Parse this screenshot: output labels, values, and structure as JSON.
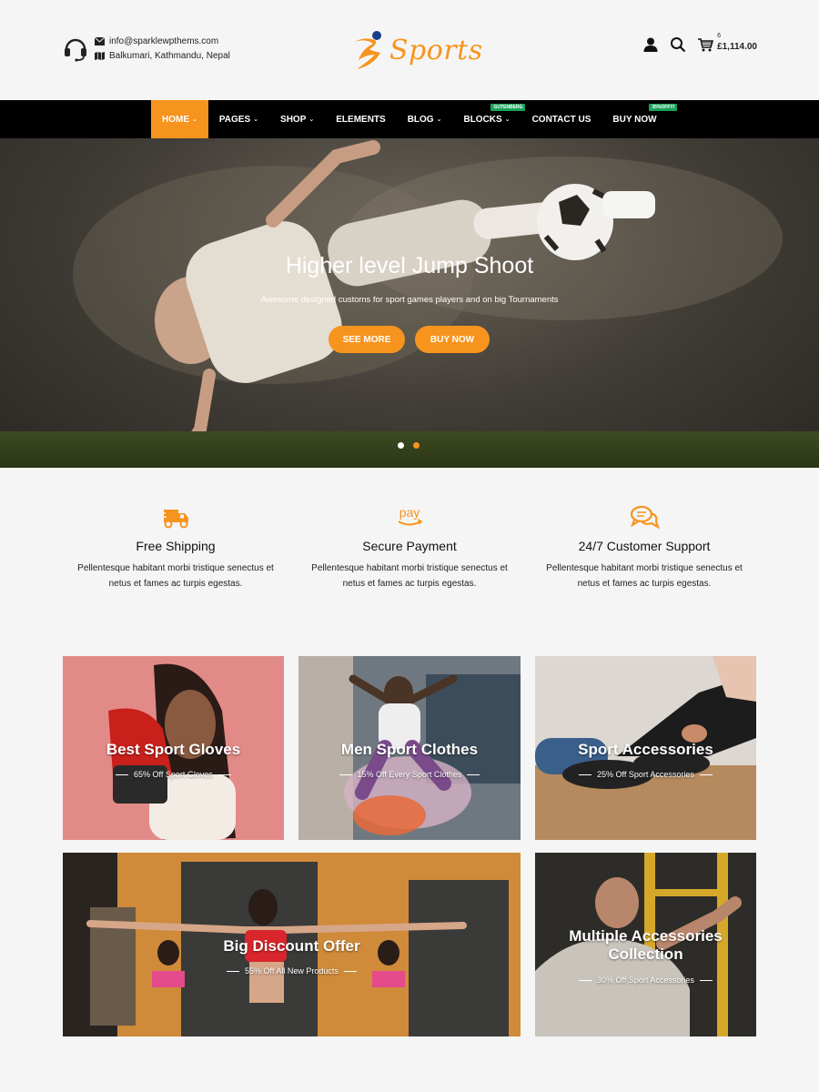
{
  "header": {
    "email": "info@sparklewpthems.com",
    "address": "Balkumari, Kathmandu, Nepal",
    "logo_text": "Sports",
    "cart_count": "6",
    "cart_total": "£1,114.00"
  },
  "nav": {
    "items": [
      {
        "label": "HOME",
        "dropdown": true,
        "active": true
      },
      {
        "label": "PAGES",
        "dropdown": true
      },
      {
        "label": "SHOP",
        "dropdown": true
      },
      {
        "label": "ELEMENTS",
        "dropdown": false
      },
      {
        "label": "BLOG",
        "dropdown": true
      },
      {
        "label": "BLOCKS",
        "dropdown": true,
        "badge": "GUTENBERG"
      },
      {
        "label": "CONTACT US",
        "dropdown": false
      },
      {
        "label": "BUY NOW",
        "dropdown": false,
        "badge": "35%OFF!!!"
      }
    ]
  },
  "hero": {
    "title": "Higher level Jump Shoot",
    "subtitle": "Awesome designed customs for sport games players and on big Tournaments",
    "primary_button": "SEE MORE",
    "secondary_button": "BUY NOW",
    "slides": 2,
    "active_slide": 2
  },
  "features": [
    {
      "icon": "truck-icon",
      "title": "Free Shipping",
      "line1": "Pellentesque habitant morbi tristique senectus et",
      "line2": "netus et fames ac turpis egestas."
    },
    {
      "icon": "pay-icon",
      "title": "Secure Payment",
      "line1": "Pellentesque habitant morbi tristique senectus et",
      "line2": "netus et fames ac turpis egestas.",
      "icon_text": "pay"
    },
    {
      "icon": "chat-icon",
      "title": "24/7 Customer Support",
      "line1": "Pellentesque habitant morbi tristique senectus et",
      "line2": "netus et fames ac turpis egestas."
    }
  ],
  "promos": [
    {
      "title": "Best Sport Gloves",
      "subtitle": "65% Off Sport Gloves"
    },
    {
      "title": "Men Sport Clothes",
      "subtitle": "15% Off Every Sport Clothes"
    },
    {
      "title": "Sport Accessories",
      "subtitle": "25% Off Sport Accessories"
    },
    {
      "title": "Big Discount Offer",
      "subtitle": "55% Off All New Products"
    },
    {
      "title_line1": "Multiple Accessories",
      "title_line2": "Collection",
      "subtitle": "30% Off Sport Accessories"
    }
  ],
  "colors": {
    "accent": "#f7941d",
    "nav_bg": "#000000",
    "badge_green": "#1aa35a"
  }
}
